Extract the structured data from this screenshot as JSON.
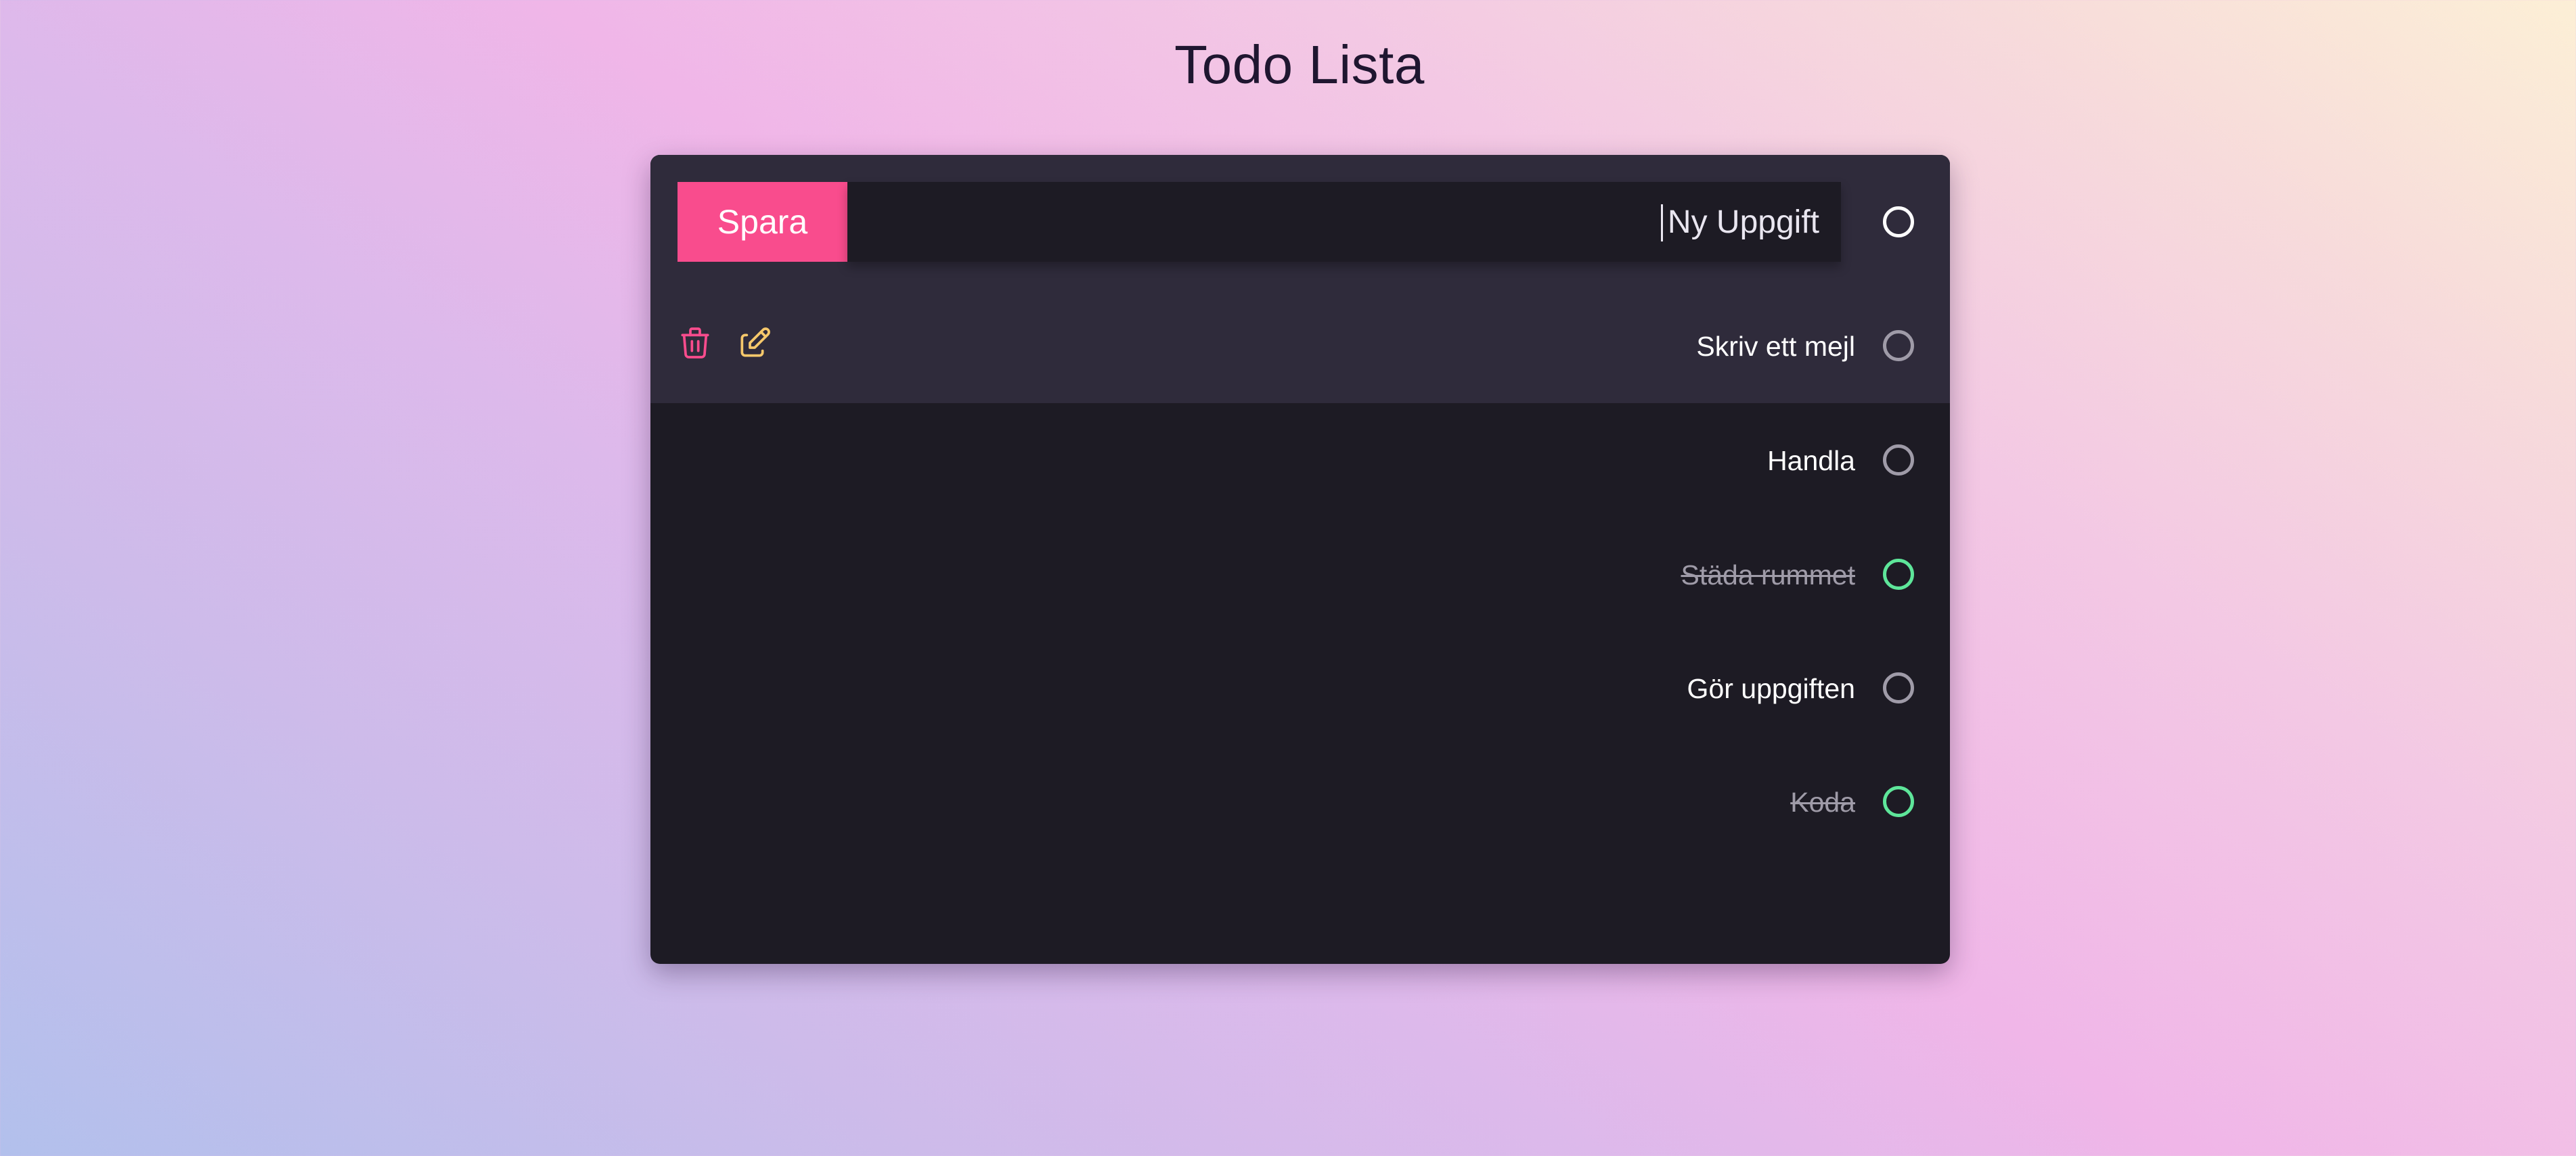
{
  "page": {
    "title": "Todo Lista"
  },
  "form": {
    "save_label": "Spara",
    "input_placeholder": "Ny Uppgift",
    "input_value": ""
  },
  "tasks": [
    {
      "label": "Skriv ett mejl",
      "completed": false,
      "selected": true,
      "actions": [
        "trash-icon",
        "edit-icon"
      ]
    },
    {
      "label": "Handla",
      "completed": false,
      "selected": false
    },
    {
      "label": "Städa rummet",
      "completed": true,
      "selected": false
    },
    {
      "label": "Gör uppgiften",
      "completed": false,
      "selected": false
    },
    {
      "label": "Koda",
      "completed": true,
      "selected": false
    }
  ],
  "colors": {
    "accent": "#f94c8d",
    "edit_icon": "#f6c86b",
    "done": "#5ee69a",
    "card_bg": "#1d1b24",
    "header_bg": "#2f2b3b",
    "muted": "#9f9ba8"
  }
}
